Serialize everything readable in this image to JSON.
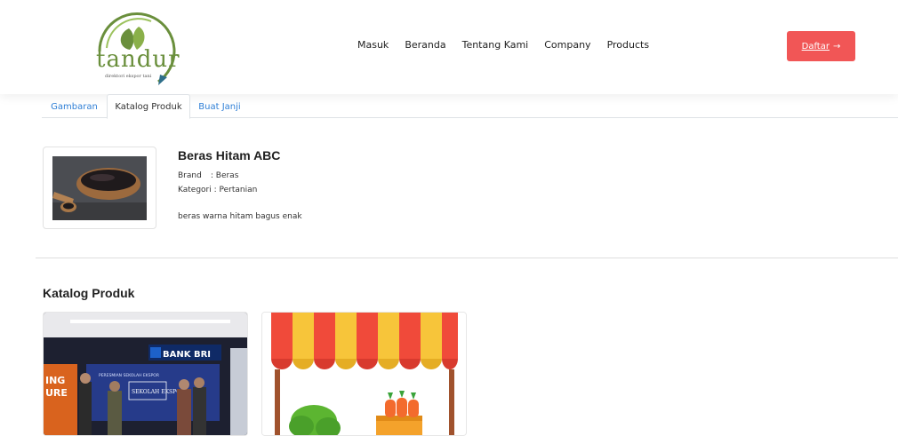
{
  "brand": {
    "logo_text": "tandur",
    "logo_sub": "direktori ekspor tani"
  },
  "nav": {
    "items": [
      "Masuk",
      "Beranda",
      "Tentang Kami",
      "Company",
      "Products"
    ],
    "cta_label": "Daftar",
    "cta_arrow": "→",
    "cta_color": "#f15656"
  },
  "tabs": [
    {
      "label": "Gambaran",
      "active": false
    },
    {
      "label": "Katalog Produk",
      "active": true
    },
    {
      "label": "Buat Janji",
      "active": false
    }
  ],
  "product": {
    "name": "Beras Hitam ABC",
    "brand_label": "Brand",
    "brand_sep": ": Beras",
    "category_label": "Kategori",
    "category_sep": ": Pertanian",
    "description": "beras warna hitam bagus enak",
    "image_icon": "black-rice-bowl"
  },
  "catalog": {
    "title": "Katalog Produk",
    "cards": [
      {
        "image": "bank-bri-event-photo",
        "sign_text": "BANK BRI",
        "banner_top": "PERESMIAN SEKOLAH EKSPOR",
        "banner_box": "SEKOLAH EKSPOR",
        "left_text": "ING\nURE"
      },
      {
        "image": "market-stall-illustration"
      }
    ]
  },
  "colors": {
    "accent": "#f15656",
    "link": "#2f7fd6",
    "logo_green": "#6a8f3c"
  }
}
